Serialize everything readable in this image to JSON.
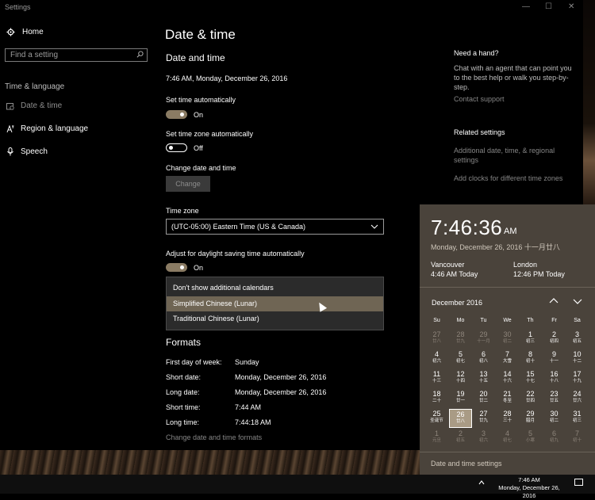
{
  "window": {
    "title": "Settings",
    "minimize": "—",
    "maximize": "☐",
    "close": "✕"
  },
  "sidebar": {
    "home": "Home",
    "search_placeholder": "Find a setting",
    "section": "Time & language",
    "items": [
      {
        "label": "Date & time",
        "icon": "date-time-icon",
        "active": true
      },
      {
        "label": "Region & language",
        "icon": "region-language-icon",
        "active": false
      },
      {
        "label": "Speech",
        "icon": "microphone-icon",
        "active": false
      }
    ]
  },
  "main": {
    "title": "Date & time",
    "subtitle": "Date and time",
    "current_datetime": "7:46 AM, Monday, December 26, 2016",
    "set_time_auto": {
      "label": "Set time automatically",
      "state": "On"
    },
    "set_tz_auto": {
      "label": "Set time zone automatically",
      "state": "Off"
    },
    "change_label": "Change date and time",
    "change_button": "Change",
    "timezone_label": "Time zone",
    "timezone_value": "(UTC-05:00) Eastern Time (US & Canada)",
    "dst_label": "Adjust for daylight saving time automatically",
    "dst_state": "On",
    "calendar_options": [
      "Don't show additional calendars",
      "Simplified Chinese (Lunar)",
      "Traditional Chinese (Lunar)"
    ],
    "formats_heading": "Formats",
    "formats": [
      {
        "key": "First day of week:",
        "value": "Sunday"
      },
      {
        "key": "Short date:",
        "value": "Monday, December 26, 2016"
      },
      {
        "key": "Long date:",
        "value": "Monday, December 26, 2016"
      },
      {
        "key": "Short time:",
        "value": "7:44 AM"
      },
      {
        "key": "Long time:",
        "value": "7:44:18 AM"
      }
    ],
    "change_formats_link": "Change date and time formats"
  },
  "right": {
    "help_heading": "Need a hand?",
    "help_text": "Chat with an agent that can point you to the best help or walk you step-by-step.",
    "contact": "Contact support",
    "related_heading": "Related settings",
    "related_1": "Additional date, time, & regional settings",
    "related_2": "Add clocks for different time zones"
  },
  "flyout": {
    "time": "7:46:36",
    "ampm": "AM",
    "date": "Monday, December 26, 2016 十一月廿八",
    "clocks": [
      {
        "city": "Vancouver",
        "time": "4:46 AM Today"
      },
      {
        "city": "London",
        "time": "12:46 PM Today"
      }
    ],
    "month": "December 2016",
    "weekdays": [
      "Su",
      "Mo",
      "Tu",
      "We",
      "Th",
      "Fr",
      "Sa"
    ],
    "days": [
      {
        "n": "27",
        "l": "廿八",
        "dim": true
      },
      {
        "n": "28",
        "l": "廿九",
        "dim": true
      },
      {
        "n": "29",
        "l": "十一月",
        "dim": true
      },
      {
        "n": "30",
        "l": "初二",
        "dim": true
      },
      {
        "n": "1",
        "l": "初三"
      },
      {
        "n": "2",
        "l": "初四"
      },
      {
        "n": "3",
        "l": "初五"
      },
      {
        "n": "4",
        "l": "初六"
      },
      {
        "n": "5",
        "l": "初七"
      },
      {
        "n": "6",
        "l": "初八"
      },
      {
        "n": "7",
        "l": "大雪"
      },
      {
        "n": "8",
        "l": "初十"
      },
      {
        "n": "9",
        "l": "十一"
      },
      {
        "n": "10",
        "l": "十二"
      },
      {
        "n": "11",
        "l": "十三"
      },
      {
        "n": "12",
        "l": "十四"
      },
      {
        "n": "13",
        "l": "十五"
      },
      {
        "n": "14",
        "l": "十六"
      },
      {
        "n": "15",
        "l": "十七"
      },
      {
        "n": "16",
        "l": "十八"
      },
      {
        "n": "17",
        "l": "十九"
      },
      {
        "n": "18",
        "l": "二十"
      },
      {
        "n": "19",
        "l": "廿一"
      },
      {
        "n": "20",
        "l": "廿二"
      },
      {
        "n": "21",
        "l": "冬至"
      },
      {
        "n": "22",
        "l": "廿四"
      },
      {
        "n": "23",
        "l": "廿五"
      },
      {
        "n": "24",
        "l": "廿六"
      },
      {
        "n": "25",
        "l": "圣诞节"
      },
      {
        "n": "26",
        "l": "廿八",
        "today": true
      },
      {
        "n": "27",
        "l": "廿九"
      },
      {
        "n": "28",
        "l": "三十"
      },
      {
        "n": "29",
        "l": "腊月"
      },
      {
        "n": "30",
        "l": "初二"
      },
      {
        "n": "31",
        "l": "初三"
      },
      {
        "n": "1",
        "l": "元旦",
        "dim": true
      },
      {
        "n": "2",
        "l": "初五",
        "dim": true
      },
      {
        "n": "3",
        "l": "初六",
        "dim": true
      },
      {
        "n": "4",
        "l": "初七",
        "dim": true
      },
      {
        "n": "5",
        "l": "小寒",
        "dim": true
      },
      {
        "n": "6",
        "l": "初九",
        "dim": true
      },
      {
        "n": "7",
        "l": "初十",
        "dim": true
      }
    ],
    "settings_link": "Date and time settings"
  },
  "taskbar": {
    "time": "7:46 AM",
    "date": "Monday, December 26, 2016"
  }
}
